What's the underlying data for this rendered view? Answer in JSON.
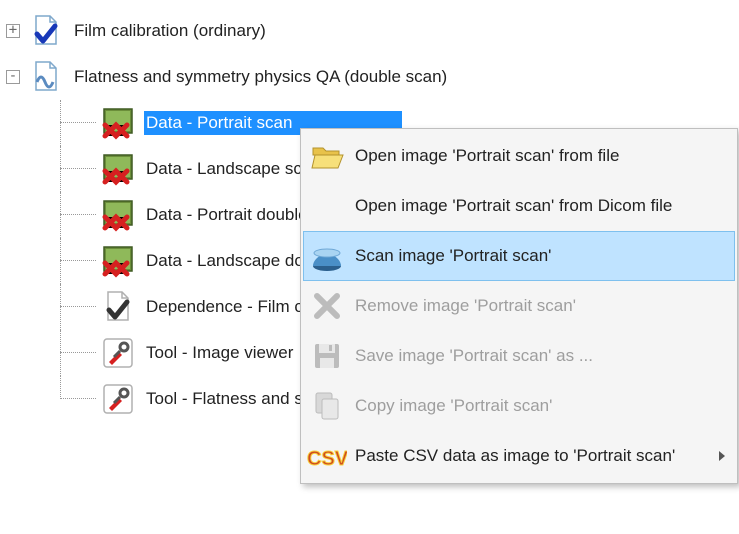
{
  "tree": {
    "root1": {
      "label": "Film calibration (ordinary)",
      "expander": "+"
    },
    "root2": {
      "label": "Flatness and symmetry physics QA (double scan)",
      "expander": "-"
    },
    "children": [
      {
        "label": "Data - Portrait scan",
        "icon": "data-missing",
        "selected": true
      },
      {
        "label": "Data - Landscape scan",
        "icon": "data-missing"
      },
      {
        "label": "Data - Portrait double",
        "icon": "data-missing"
      },
      {
        "label": "Data - Landscape double",
        "icon": "data-missing"
      },
      {
        "label": "Dependence - Film calibration",
        "icon": "dependence"
      },
      {
        "label": "Tool - Image viewer",
        "icon": "tool"
      },
      {
        "label": "Tool - Flatness and symmetry",
        "icon": "tool"
      }
    ]
  },
  "contextMenu": {
    "items": [
      {
        "label": "Open image 'Portrait scan' from file",
        "icon": "folder-open",
        "enabled": true
      },
      {
        "label": "Open image 'Portrait scan' from Dicom file",
        "icon": "none",
        "enabled": true
      },
      {
        "label": "Scan image 'Portrait scan'",
        "icon": "scanner",
        "enabled": true,
        "hover": true
      },
      {
        "label": "Remove image 'Portrait scan'",
        "icon": "delete-x",
        "enabled": false
      },
      {
        "label": "Save image 'Portrait scan' as ...",
        "icon": "save",
        "enabled": false
      },
      {
        "label": "Copy image 'Portrait scan'",
        "icon": "copy",
        "enabled": false
      },
      {
        "label": "Paste CSV data as image to 'Portrait scan'",
        "icon": "csv",
        "enabled": true,
        "submenu": true
      }
    ]
  }
}
